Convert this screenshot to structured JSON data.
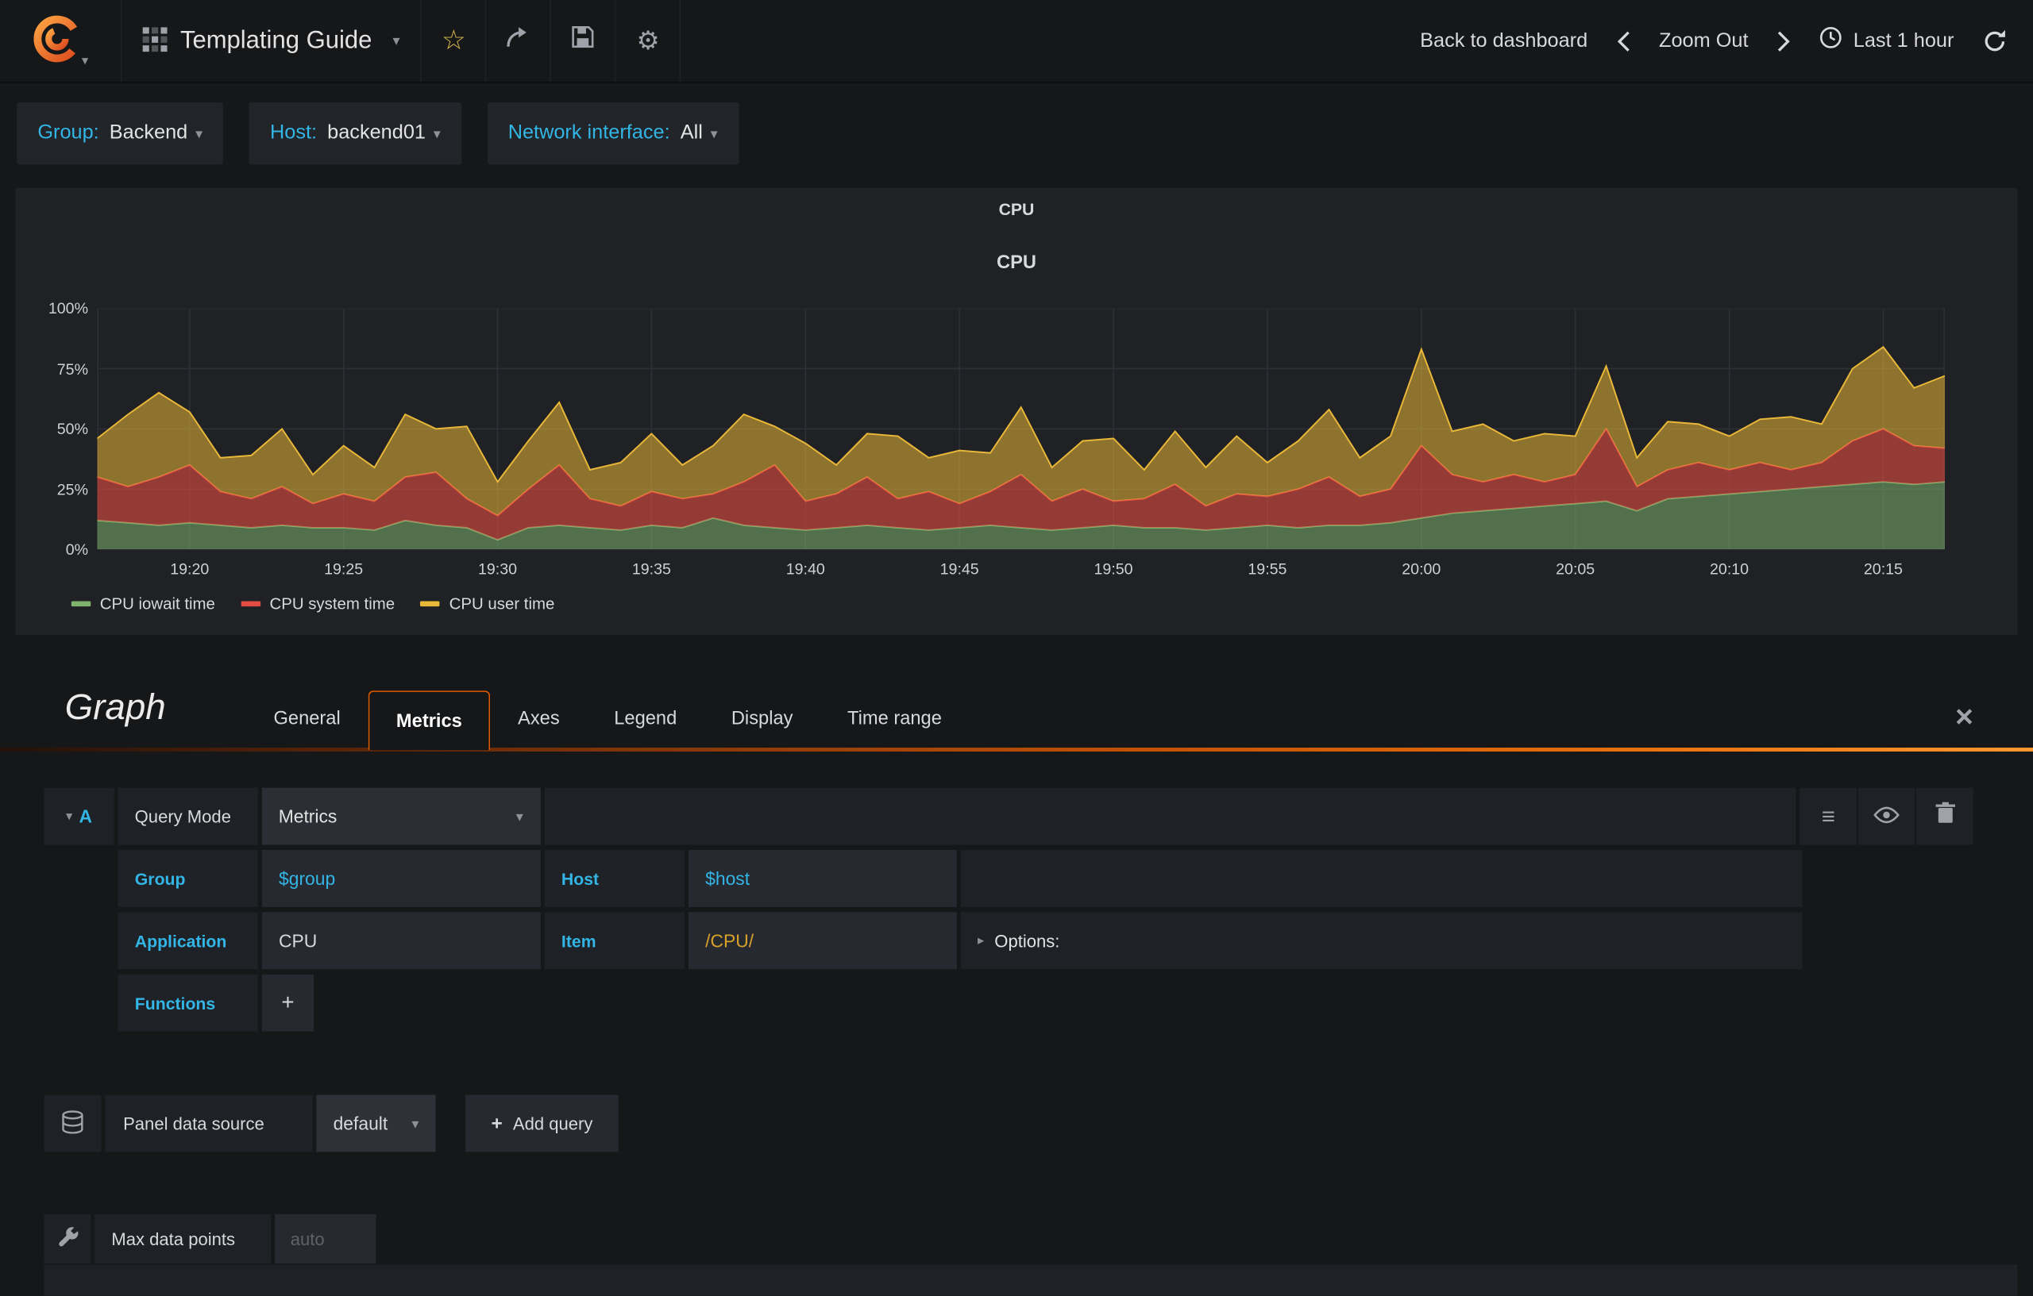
{
  "navbar": {
    "title": "Templating Guide",
    "back_to_dashboard": "Back to dashboard",
    "zoom_out": "Zoom Out",
    "time_range": "Last 1 hour"
  },
  "variables": [
    {
      "label": "Group:",
      "value": "Backend"
    },
    {
      "label": "Host:",
      "value": "backend01"
    },
    {
      "label": "Network interface:",
      "value": "All"
    }
  ],
  "panel": {
    "header": "CPU"
  },
  "chart_data": {
    "type": "area",
    "stacked": true,
    "title": "CPU",
    "xlabel": "",
    "ylabel": "",
    "ylim": [
      0,
      100
    ],
    "grid": true,
    "legend_position": "bottom-left",
    "x_axis": "time, 19:17 to 20:17, one point per minute",
    "y_ticks": [
      {
        "v": 0,
        "label": "0%"
      },
      {
        "v": 25,
        "label": "25%"
      },
      {
        "v": 50,
        "label": "50%"
      },
      {
        "v": 75,
        "label": "75%"
      },
      {
        "v": 100,
        "label": "100%"
      }
    ],
    "x_ticks": [
      {
        "i": 3,
        "label": "19:20"
      },
      {
        "i": 8,
        "label": "19:25"
      },
      {
        "i": 13,
        "label": "19:30"
      },
      {
        "i": 18,
        "label": "19:35"
      },
      {
        "i": 23,
        "label": "19:40"
      },
      {
        "i": 28,
        "label": "19:45"
      },
      {
        "i": 33,
        "label": "19:50"
      },
      {
        "i": 38,
        "label": "19:55"
      },
      {
        "i": 43,
        "label": "20:00"
      },
      {
        "i": 48,
        "label": "20:05"
      },
      {
        "i": 53,
        "label": "20:10"
      },
      {
        "i": 58,
        "label": "20:15"
      }
    ],
    "series": [
      {
        "name": "CPU iowait time",
        "color": "#7EB26D",
        "fill_opacity": 0.55,
        "values": [
          12,
          11,
          10,
          11,
          10,
          9,
          10,
          9,
          9,
          8,
          12,
          10,
          9,
          4,
          9,
          10,
          9,
          8,
          10,
          9,
          13,
          10,
          9,
          8,
          9,
          10,
          9,
          8,
          9,
          10,
          9,
          8,
          9,
          10,
          9,
          9,
          8,
          9,
          10,
          9,
          10,
          10,
          11,
          13,
          15,
          16,
          17,
          18,
          19,
          20,
          16,
          21,
          22,
          23,
          24,
          25,
          26,
          27,
          28,
          27,
          28
        ]
      },
      {
        "name": "CPU system time",
        "color": "#E24D42",
        "fill_opacity": 0.6,
        "values": [
          18,
          15,
          20,
          24,
          14,
          12,
          16,
          10,
          14,
          12,
          18,
          22,
          12,
          10,
          16,
          25,
          12,
          10,
          14,
          12,
          10,
          18,
          26,
          12,
          14,
          20,
          12,
          16,
          10,
          14,
          22,
          12,
          16,
          10,
          12,
          18,
          10,
          14,
          12,
          16,
          20,
          12,
          14,
          30,
          16,
          12,
          14,
          10,
          12,
          30,
          10,
          12,
          14,
          10,
          12,
          8,
          10,
          18,
          22,
          16,
          14
        ]
      },
      {
        "name": "CPU user time",
        "color": "#EAB839",
        "fill_opacity": 0.55,
        "values": [
          16,
          30,
          35,
          22,
          14,
          18,
          24,
          12,
          20,
          14,
          26,
          18,
          30,
          14,
          20,
          26,
          12,
          18,
          24,
          14,
          20,
          28,
          16,
          24,
          12,
          18,
          26,
          14,
          22,
          16,
          28,
          14,
          20,
          26,
          12,
          22,
          16,
          24,
          14,
          20,
          28,
          16,
          22,
          40,
          18,
          24,
          14,
          20,
          16,
          26,
          12,
          20,
          16,
          14,
          18,
          22,
          16,
          30,
          34,
          24,
          30
        ]
      }
    ]
  },
  "editor": {
    "panel_type": "Graph",
    "tabs": [
      {
        "label": "General"
      },
      {
        "label": "Metrics"
      },
      {
        "label": "Axes"
      },
      {
        "label": "Legend"
      },
      {
        "label": "Display"
      },
      {
        "label": "Time range"
      }
    ],
    "active_tab": "Metrics",
    "query": {
      "ref": "A",
      "query_mode_label": "Query Mode",
      "query_mode_value": "Metrics",
      "group_label": "Group",
      "group_value": "$group",
      "host_label": "Host",
      "host_value": "$host",
      "application_label": "Application",
      "application_value": "CPU",
      "item_label": "Item",
      "item_value": "/CPU/",
      "options_label": "Options:",
      "functions_label": "Functions",
      "add_function_label": "+"
    },
    "datasource": {
      "label": "Panel data source",
      "value": "default",
      "add_query_label": "Add query"
    },
    "max_data_points": {
      "label": "Max data points",
      "placeholder": "auto"
    }
  }
}
